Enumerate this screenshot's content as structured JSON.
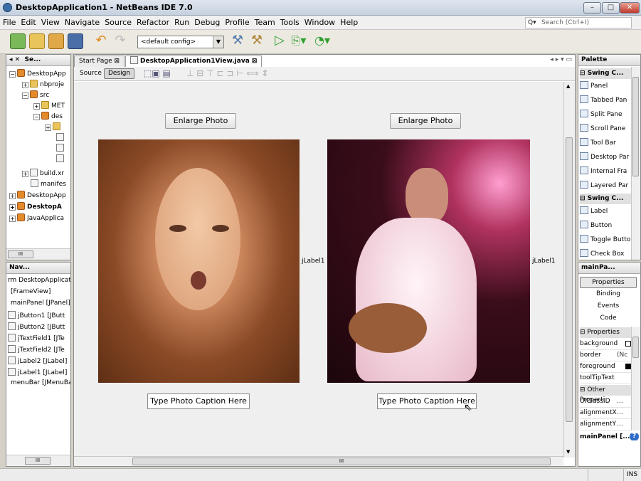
{
  "window": {
    "title": "DesktopApplication1 - NetBeans IDE 7.0",
    "minimize": "–",
    "maximize": "□",
    "close": "✕"
  },
  "menu": [
    "File",
    "Edit",
    "View",
    "Navigate",
    "Source",
    "Refactor",
    "Run",
    "Debug",
    "Profile",
    "Team",
    "Tools",
    "Window",
    "Help"
  ],
  "search": {
    "placeholder": "Search (Ctrl+I)",
    "icon": "Q▾"
  },
  "toolbar": {
    "config": "<default config>"
  },
  "projects_panel": {
    "title": "Se...",
    "tab_icons": "◂ ✕",
    "items": [
      "DesktopApp",
      "nbproje",
      "src",
      "MET",
      "des",
      "build.xr",
      "manifes",
      "DesktopApp",
      "DesktopA",
      "JavaApplica"
    ],
    "scroll_label": "III"
  },
  "navigator": {
    "title": "Nav...",
    "items": [
      "rm DesktopApplicatio",
      "[FrameView]",
      "mainPanel [JPanel]",
      "jButton1 [JButt",
      "jButton2 [JButt",
      "jTextField1 [JTe",
      "jTextField2 [JTe",
      "jLabel2 [JLabel]",
      "jLabel1 [JLabel]",
      "menuBar [JMenuBa"
    ],
    "scroll_label": "III"
  },
  "editor": {
    "tabs": [
      "Start Page",
      "DesktopApplication1View.java"
    ],
    "source_label": "Source",
    "design_label": "Design",
    "scroll_label": "III"
  },
  "form": {
    "button1": "Enlarge Photo",
    "button2": "Enlarge Photo",
    "label1": "jLabel1",
    "label2": "jLabel1",
    "field1": "Type Photo Caption Here",
    "field2": "Type Photo Caption Here"
  },
  "palette": {
    "title": "Palette",
    "items": [
      {
        "type": "cat",
        "label": "Swing C..."
      },
      {
        "type": "item",
        "label": "Panel"
      },
      {
        "type": "item",
        "label": "Tabbed Pan"
      },
      {
        "type": "item",
        "label": "Split Pane"
      },
      {
        "type": "item",
        "label": "Scroll Pane"
      },
      {
        "type": "item",
        "label": "Tool Bar"
      },
      {
        "type": "item",
        "label": "Desktop Par"
      },
      {
        "type": "item",
        "label": "Internal Fra"
      },
      {
        "type": "item",
        "label": "Layered Par"
      },
      {
        "type": "cat",
        "label": "Swing C..."
      },
      {
        "type": "item",
        "label": "Label"
      },
      {
        "type": "item",
        "label": "Button"
      },
      {
        "type": "item",
        "label": "Toggle Butto"
      },
      {
        "type": "item",
        "label": "Check Box"
      }
    ]
  },
  "properties": {
    "title": "mainPa...",
    "tabs": [
      "Properties",
      "Binding",
      "Events",
      "Code"
    ],
    "section1": "Properties",
    "rows1": [
      {
        "name": "background",
        "value": ""
      },
      {
        "name": "border",
        "value": "(Nc"
      },
      {
        "name": "foreground",
        "value": ""
      },
      {
        "name": "toolTipText",
        "value": ""
      }
    ],
    "section2": "Other Properti",
    "rows2": [
      {
        "name": "UIClassID",
        "value": "..."
      },
      {
        "name": "alignmentX",
        "value": "..."
      },
      {
        "name": "alignmentY",
        "value": "..."
      }
    ],
    "footer": "mainPanel [..."
  },
  "status": {
    "mode": "INS"
  }
}
